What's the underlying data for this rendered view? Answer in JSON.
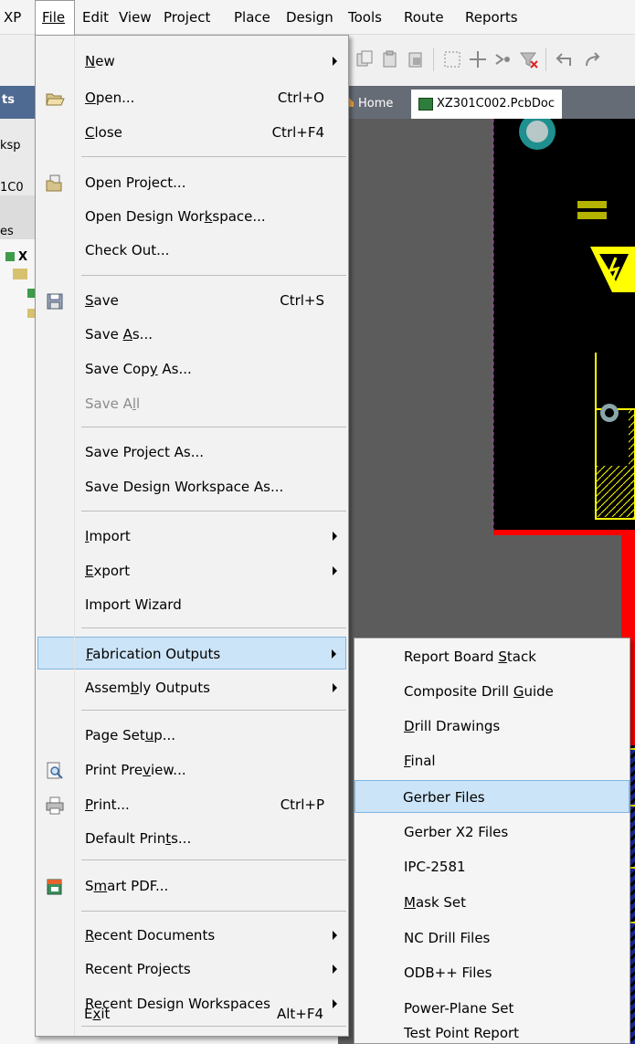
{
  "menubar": {
    "items": [
      "XP",
      "File",
      "Edit",
      "View",
      "Project",
      "Place",
      "Design",
      "Tools",
      "Route",
      "Reports"
    ],
    "active": "File"
  },
  "left_panel": {
    "labels": [
      "ts",
      "ksp",
      "1C0",
      "es",
      "X"
    ]
  },
  "doc_tabs": {
    "home": "Home",
    "active": "XZ301C002.PcbDoc"
  },
  "file_menu": {
    "items": [
      {
        "label": "New",
        "mnemonic": "N",
        "submenu": true
      },
      {
        "label": "Open...",
        "mnemonic": "O",
        "shortcut": "Ctrl+O",
        "icon": "open-folder-icon"
      },
      {
        "label": "Close",
        "mnemonic": "C",
        "shortcut": "Ctrl+F4"
      },
      {
        "label": "Open Project...",
        "icon": "open-project-icon"
      },
      {
        "label": "Open Design Workspace...",
        "mnemonic": "k"
      },
      {
        "label": "Check Out..."
      },
      {
        "label": "Save",
        "mnemonic": "S",
        "shortcut": "Ctrl+S",
        "icon": "save-icon"
      },
      {
        "label": "Save As...",
        "mnemonic": "A"
      },
      {
        "label": "Save Copy As...",
        "mnemonic": "y"
      },
      {
        "label": "Save All",
        "mnemonic": "l",
        "disabled": true
      },
      {
        "label": "Save Project As..."
      },
      {
        "label": "Save Design Workspace As..."
      },
      {
        "label": "Import",
        "mnemonic": "I",
        "submenu": true
      },
      {
        "label": "Export",
        "mnemonic": "E",
        "submenu": true
      },
      {
        "label": "Import Wizard"
      },
      {
        "label": "Fabrication Outputs",
        "mnemonic": "F",
        "submenu": true,
        "highlighted": true
      },
      {
        "label": "Assembly Outputs",
        "mnemonic": "b",
        "submenu": true
      },
      {
        "label": "Page Setup...",
        "mnemonic": "u"
      },
      {
        "label": "Print Preview...",
        "mnemonic": "v",
        "icon": "print-preview-icon"
      },
      {
        "label": "Print...",
        "mnemonic": "P",
        "shortcut": "Ctrl+P",
        "icon": "printer-icon"
      },
      {
        "label": "Default Prints...",
        "mnemonic": "t"
      },
      {
        "label": "Smart PDF...",
        "mnemonic": "m",
        "icon": "smart-pdf-icon"
      },
      {
        "label": "Recent Documents",
        "mnemonic": "R",
        "submenu": true
      },
      {
        "label": "Recent Projects",
        "submenu": true
      },
      {
        "label": "Recent Design Workspaces",
        "submenu": true
      },
      {
        "label": "Exit",
        "mnemonic": "x",
        "shortcut": "Alt+F4"
      }
    ]
  },
  "fabrication_submenu": {
    "items": [
      {
        "label": "Report Board Stack",
        "mnemonic": "S"
      },
      {
        "label": "Composite Drill Guide",
        "mnemonic": "G"
      },
      {
        "label": "Drill Drawings",
        "mnemonic": "D"
      },
      {
        "label": "Final",
        "mnemonic": "F"
      },
      {
        "label": "Gerber Files",
        "highlighted": true
      },
      {
        "label": "Gerber X2 Files"
      },
      {
        "label": "IPC-2581"
      },
      {
        "label": "Mask Set",
        "mnemonic": "M"
      },
      {
        "label": "NC Drill Files"
      },
      {
        "label": "ODB++ Files"
      },
      {
        "label": "Power-Plane Set"
      },
      {
        "label": "Test Point Report"
      }
    ]
  },
  "colors": {
    "highlight": "#cce4f7",
    "highlight_border": "#7fb6e2",
    "pcb_background": "#000000",
    "pcb_silkscreen": "#ffff00",
    "pcb_pad": "#8aa7a9"
  }
}
